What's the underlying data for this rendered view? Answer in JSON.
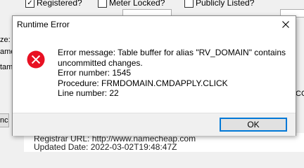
{
  "background": {
    "checkboxes": [
      {
        "label": "Registered?",
        "checked": true
      },
      {
        "label": "Meter Locked?",
        "checked": false
      },
      {
        "label": "Publicly Listed?",
        "checked": false
      }
    ],
    "edge_labels": [
      "ze:",
      "ame",
      "tam"
    ],
    "edge_button_label": "nc",
    "right_edge_text": "CC",
    "registrar_url_line": "Registrar URL: http://www.namecheap.com",
    "updated_date_line": "Updated Date: 2022-03-02T19:48:47Z"
  },
  "dialog": {
    "title": "Runtime Error",
    "icon": "error-circle-x-icon",
    "icon_color": "#e81123",
    "message_lines": [
      "Error message: Table buffer for alias \"RV_DOMAIN\" contains",
      "uncommitted changes.",
      "Error number: 1545",
      "Procedure: FRMDOMAIN.CMDAPPLY.CLICK",
      "Line number: 22"
    ],
    "ok_label": "OK",
    "accent_color": "#0078d7"
  }
}
